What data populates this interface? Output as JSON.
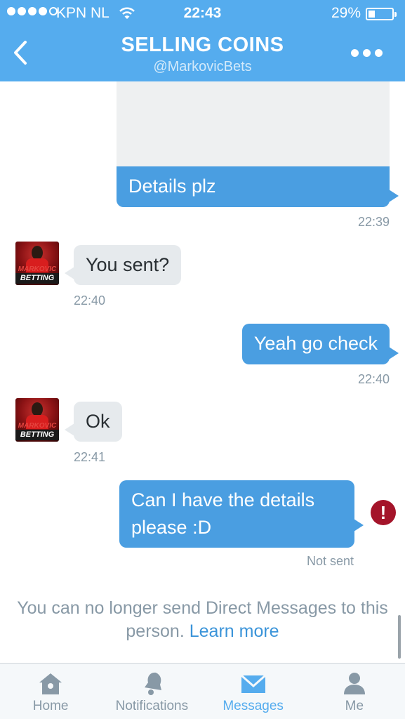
{
  "status_bar": {
    "carrier": "KPN NL",
    "time": "22:43",
    "battery_pct": "29%",
    "battery_level": 0.29
  },
  "header": {
    "title": "SELLING COINS",
    "handle": "@MarkovicBets"
  },
  "avatar": {
    "line1": "MARKOVIC",
    "line2": "BETTING"
  },
  "messages": [
    {
      "direction": "out",
      "text": "Details plz",
      "time": "22:39"
    },
    {
      "direction": "in",
      "text": "You sent?",
      "time": "22:40"
    },
    {
      "direction": "out",
      "text": "Yeah go check",
      "time": "22:40"
    },
    {
      "direction": "in",
      "text": "Ok",
      "time": "22:41"
    },
    {
      "direction": "out",
      "text": "Can I have the details please :D",
      "status": "Not sent"
    }
  ],
  "notice": {
    "text": "You can no longer send Direct Messages to this person.",
    "link": "Learn more"
  },
  "tabs": [
    {
      "label": "Home",
      "icon": "home-icon"
    },
    {
      "label": "Notifications",
      "icon": "bell-icon"
    },
    {
      "label": "Messages",
      "icon": "envelope-icon",
      "active": true
    },
    {
      "label": "Me",
      "icon": "person-icon"
    }
  ],
  "colors": {
    "brand": "#55acee",
    "outgoing_bubble": "#4a9ee1",
    "incoming_bubble": "#e6eaed",
    "error": "#a4142a"
  }
}
